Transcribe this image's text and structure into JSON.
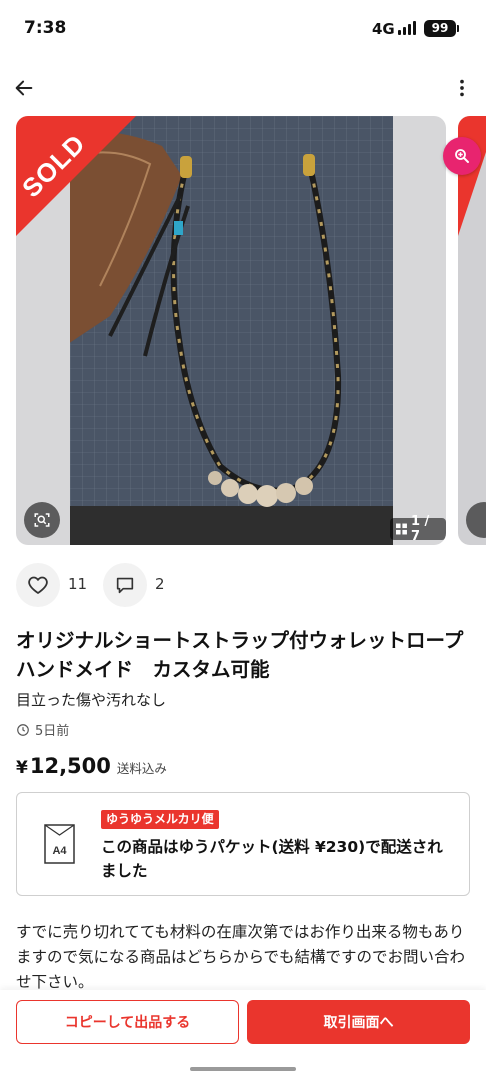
{
  "status_bar": {
    "time": "7:38",
    "network": "4G",
    "battery": "99"
  },
  "icons": {
    "back": "arrow-left-icon",
    "more": "more-vertical-icon",
    "magnify": "zoom-in-icon",
    "image_search": "image-scan-icon",
    "gallery": "grid-icon",
    "like": "heart-icon",
    "comment": "comment-icon",
    "clock": "clock-icon",
    "a4": "a4-envelope-icon"
  },
  "gallery": {
    "sold_label": "SOLD",
    "counter": "1 / 7"
  },
  "stats": {
    "likes": "11",
    "comments": "2"
  },
  "item": {
    "title": "オリジナルショートストラップ付ウォレットロープ　ハンドメイド　カスタム可能",
    "condition": "目立った傷や汚れなし",
    "posted": "5日前",
    "price_currency": "¥",
    "price": "12,500",
    "price_note": "送料込み"
  },
  "shipping": {
    "badge": "ゆうゆうメルカリ便",
    "icon_label": "A4",
    "text": "この商品はゆうパケット(送料 ¥230)で配送されました"
  },
  "description": "すでに売り切れてても材料の在庫次第ではお作り出来る物もありますので気になる商品はどちらからでも結構ですのでお問い合わせ下さい。",
  "actions": {
    "copy_label": "コピーして出品する",
    "trade_label": "取引画面へ"
  },
  "colors": {
    "accent": "#ea352d",
    "magnify": "#e8246f"
  }
}
